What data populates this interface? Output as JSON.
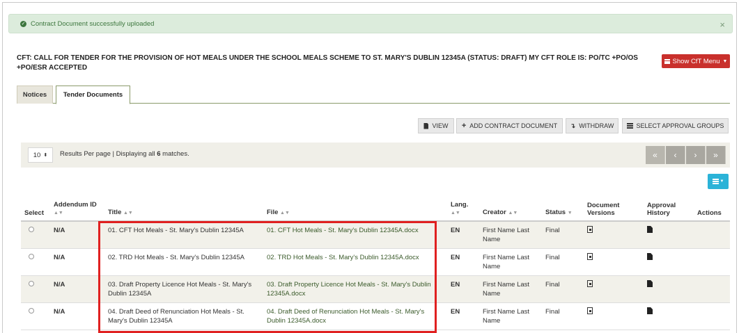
{
  "alert": {
    "message": "Contract Document successfully uploaded",
    "close": "×"
  },
  "heading": {
    "title": "CFT: CALL FOR TENDER FOR THE PROVISION OF HOT MEALS UNDER THE SCHOOL MEALS SCHEME TO ST. MARY'S DUBLIN 12345A",
    "status": "(STATUS: DRAFT) MY CFT ROLE IS: PO/TC +PO/OS +PO/ESR ACCEPTED"
  },
  "cft_menu": {
    "label": "Show CfT Menu"
  },
  "tabs": [
    {
      "label": "Notices"
    },
    {
      "label": "Tender Documents"
    }
  ],
  "toolbar": {
    "view": "VIEW",
    "add": "ADD CONTRACT DOCUMENT",
    "withdraw": "WITHDRAW",
    "approval": "SELECT APPROVAL GROUPS"
  },
  "pager": {
    "per_page": "10",
    "text_prefix": "Results Per page | Displaying all ",
    "count": "6",
    "text_suffix": " matches.",
    "first": "«",
    "prev": "‹",
    "next": "›",
    "last": "»"
  },
  "table": {
    "headers": {
      "select": "Select",
      "addendum": "Addendum ID",
      "title": "Title",
      "file": "File",
      "lang": "Lang.",
      "creator": "Creator",
      "status": "Status",
      "versions": "Document Versions",
      "approval": "Approval History",
      "actions": "Actions"
    },
    "rows": [
      {
        "addendum": "N/A",
        "title": "01. CFT Hot Meals - St. Mary's Dublin 12345A",
        "file": "01. CFT Hot Meals - St. Mary's Dublin 12345A.docx",
        "lang": "EN",
        "creator": "First Name Last Name",
        "status": "Final"
      },
      {
        "addendum": "N/A",
        "title": "02. TRD Hot Meals - St. Mary's Dublin 12345A",
        "file": "02. TRD Hot Meals - St. Mary's Dublin 12345A.docx",
        "lang": "EN",
        "creator": "First Name Last Name",
        "status": "Final"
      },
      {
        "addendum": "N/A",
        "title": "03. Draft Property Licence Hot Meals - St. Mary's Dublin 12345A",
        "file": "03. Draft Property Licence Hot Meals - St. Mary's Dublin 12345A.docx",
        "lang": "EN",
        "creator": "First Name Last Name",
        "status": "Final"
      },
      {
        "addendum": "N/A",
        "title": "04. Draft Deed of Renunciation Hot Meals - St. Mary's Dublin 12345A",
        "file": "04. Draft Deed of Renunciation Hot Meals - St. Mary's Dublin 12345A.docx",
        "lang": "EN",
        "creator": "First Name Last Name",
        "status": "Final"
      }
    ]
  },
  "colors": {
    "accent_red": "#c9302c",
    "highlight": "#e02020",
    "alert_bg": "#dcecdc",
    "columns_btn": "#2bb3d8"
  }
}
